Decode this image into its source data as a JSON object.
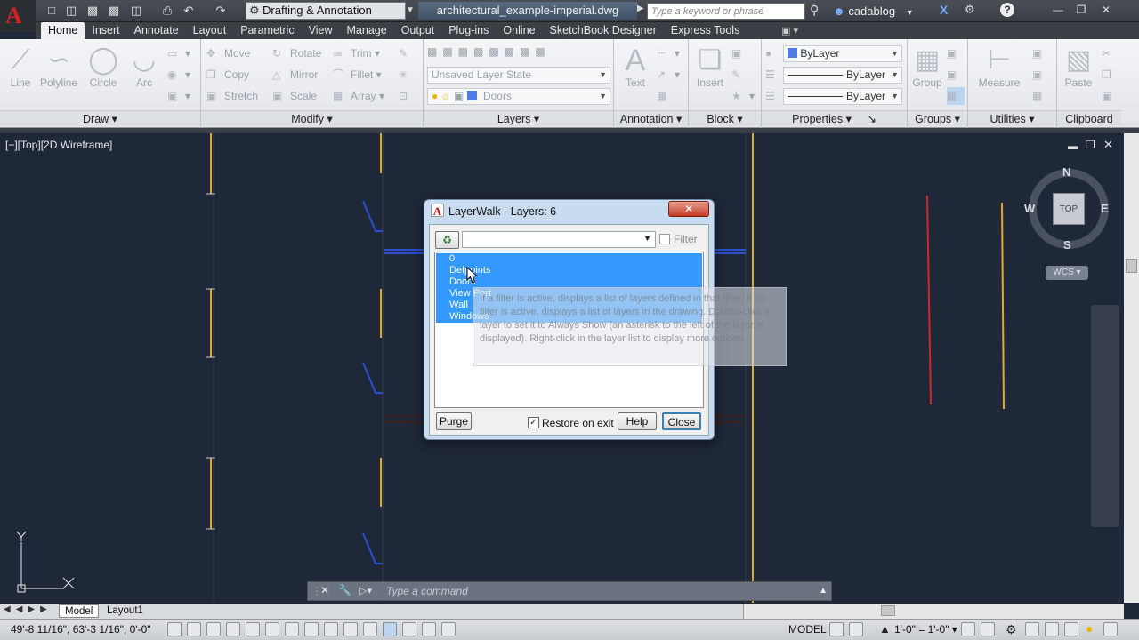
{
  "app": {
    "workspace": "Drafting & Annotation",
    "document_title": "architectural_example-imperial.dwg",
    "search_placeholder": "Type a keyword or phrase",
    "user": "cadablog"
  },
  "ribbon_tabs": [
    "Home",
    "Insert",
    "Annotate",
    "Layout",
    "Parametric",
    "View",
    "Manage",
    "Output",
    "Plug-ins",
    "Online",
    "SketchBook Designer",
    "Express Tools"
  ],
  "active_tab": "Home",
  "panels": {
    "draw": {
      "title": "Draw",
      "line": "Line",
      "polyline": "Polyline",
      "circle": "Circle",
      "arc": "Arc"
    },
    "modify": {
      "title": "Modify",
      "move": "Move",
      "rotate": "Rotate",
      "trim": "Trim",
      "copy": "Copy",
      "mirror": "Mirror",
      "fillet": "Fillet",
      "stretch": "Stretch",
      "scale": "Scale",
      "array": "Array"
    },
    "layers": {
      "title": "Layers",
      "layer_state": "Unsaved Layer State",
      "current_layer": "Doors"
    },
    "annotation": {
      "title": "Annotation",
      "text": "Text"
    },
    "block": {
      "title": "Block",
      "insert": "Insert"
    },
    "properties": {
      "title": "Properties",
      "color": "ByLayer",
      "linetype": "ByLayer",
      "lineweight": "ByLayer"
    },
    "groups": {
      "title": "Groups",
      "group": "Group"
    },
    "utilities": {
      "title": "Utilities",
      "measure": "Measure"
    },
    "clipboard": {
      "title": "Clipboard",
      "paste": "Paste"
    }
  },
  "viewport_label": "[−][Top][2D Wireframe]",
  "viewcube": {
    "top": "TOP",
    "n": "N",
    "s": "S",
    "e": "E",
    "w": "W",
    "wcs": "WCS"
  },
  "dialog": {
    "title": "LayerWalk - Layers: 6",
    "filter_label": "Filter",
    "layers": [
      "0",
      "Defpoints",
      "Doors",
      "View Port",
      "Wall",
      "Windows"
    ],
    "tooltip": "If a filter is active, displays a list of layers defined in that filter. If no filter is active, displays a list of layers in the drawing. Double-click a layer to set it to Always Show (an asterisk to the left of the layer is displayed). Right-click in the layer list to display more options.",
    "purge": "Purge",
    "restore_on_exit": "Restore on exit",
    "help": "Help",
    "close": "Close"
  },
  "command_line": {
    "placeholder": "Type a command"
  },
  "layout_tabs": [
    "Model",
    "Layout1"
  ],
  "status": {
    "coordinates": "49'-8 11/16\", 63'-3 1/16\", 0'-0\"",
    "space": "MODEL",
    "annotation_scale": "1'-0\" = 1'-0\""
  },
  "colors": {
    "accent": "#3399ff",
    "yellow_line": "#e8b830",
    "red_line": "#d02828",
    "blue_door": "#2a4fd0",
    "canvas": "#1f2838"
  }
}
